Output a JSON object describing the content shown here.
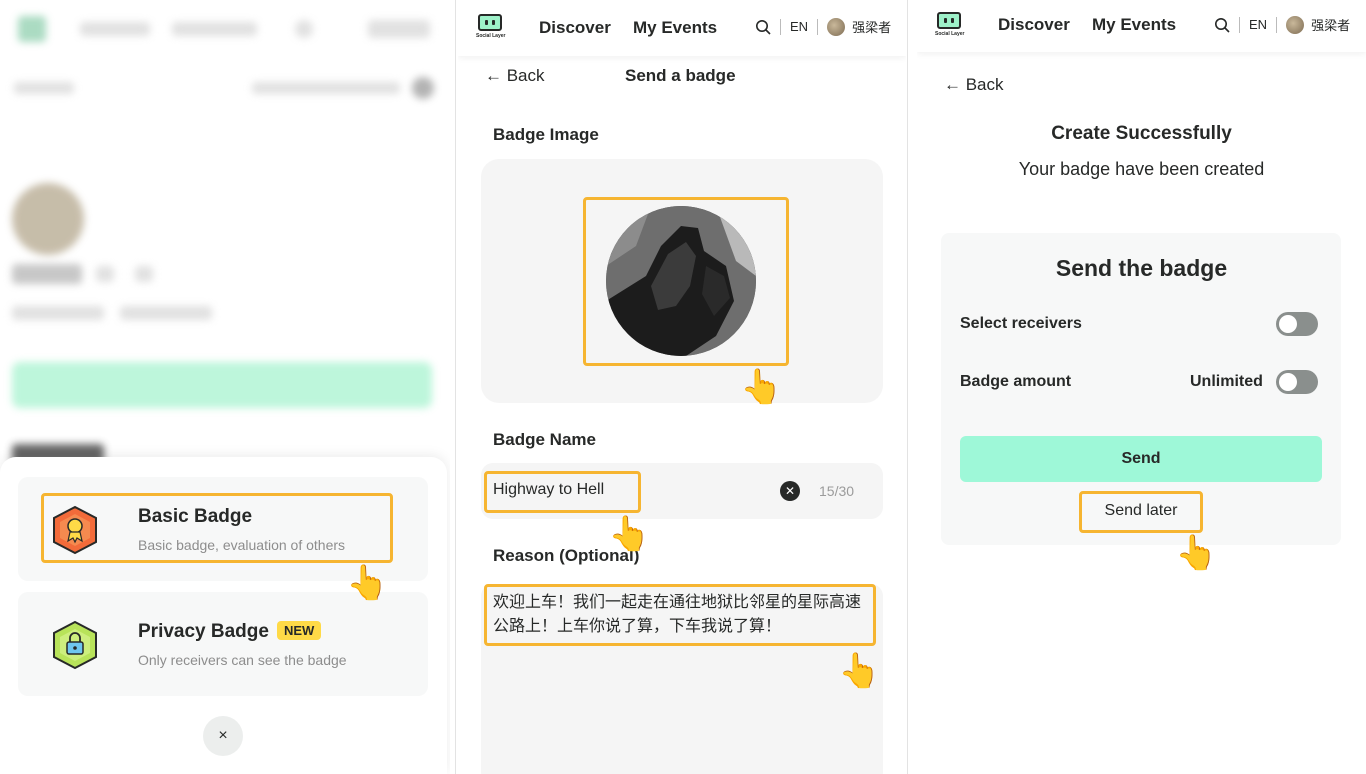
{
  "header": {
    "logo_text": "Social Layer",
    "nav": [
      "Discover",
      "My Events"
    ],
    "lang": "EN",
    "user": "强梁者",
    "search_icon": "search-icon"
  },
  "panel1": {
    "options": [
      {
        "title": "Basic Badge",
        "desc": "Basic badge, evaluation of others",
        "icon": "basic-badge-icon",
        "icon_color": "#f26b3a"
      },
      {
        "title": "Privacy Badge",
        "badge": "NEW",
        "desc": "Only receivers can see the badge",
        "icon": "privacy-badge-icon",
        "icon_color": "#b8e35a"
      }
    ],
    "close": "×"
  },
  "panel2": {
    "back": "← Back",
    "title": "Send a badge",
    "image_label": "Badge Image",
    "name_label": "Badge Name",
    "name_value": "Highway to Hell",
    "name_counter": "15/30",
    "reason_label": "Reason (Optional)",
    "reason_value": "欢迎上车！我们一起走在通往地狱比邻星的星际高速公路上！上车你说了算，下车我说了算！"
  },
  "panel3": {
    "back": "← Back",
    "title": "Create Successfully",
    "subtitle": "Your badge have been created",
    "send_title": "Send the badge",
    "select_receivers": "Select receivers",
    "badge_amount": "Badge amount",
    "amount_value": "Unlimited",
    "send": "Send",
    "send_later": "Send later"
  },
  "colors": {
    "accent": "#9ef8d8",
    "highlight": "#f6b531",
    "new_badge": "#ffda47"
  }
}
